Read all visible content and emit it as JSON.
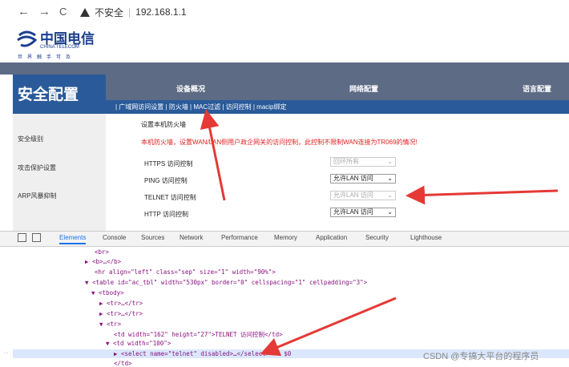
{
  "browser": {
    "back": "←",
    "forward": "→",
    "reload": "C",
    "security_text": "不安全",
    "url": "192.168.1.1"
  },
  "logo": {
    "cn": "中国电信",
    "en": "CHINA TELECOM",
    "sub": "世界触手可及"
  },
  "header": {
    "title": "安全配置",
    "menu": [
      "设备概况",
      "网络配置",
      "语言配置"
    ],
    "submenu": "| 广域网访问设置 | 防火墙 | MAC过滤 | 访问控制 | macip绑定"
  },
  "sidebar": {
    "items": [
      "安全级别",
      "攻击保护设置",
      "ARP风暴抑制"
    ]
  },
  "content": {
    "title": "设置本机防火墙",
    "warning": "本机防火墙，设置WAN/LAN侧用户政企网关的访问控制，此控制不限制WAN连接为TR069的情况!",
    "rows": [
      {
        "label": "HTTPS 访问控制",
        "value": "回环所有",
        "disabled": true
      },
      {
        "label": "PING 访问控制",
        "value": "允许LAN 访问",
        "disabled": false
      },
      {
        "label": "TELNET 访问控制",
        "value": "允许LAN 访问",
        "disabled": true
      },
      {
        "label": "HTTP 访问控制",
        "value": "允许LAN 访问",
        "disabled": false
      }
    ]
  },
  "devtools": {
    "tabs": [
      "Elements",
      "Console",
      "Sources",
      "Network",
      "Performance",
      "Memory",
      "Application",
      "Security",
      "Lighthouse"
    ],
    "active_tab": "Elements",
    "code_lines": [
      "<br>",
      "▶ <b>…</b>",
      "<hr align=\"left\" class=\"sep\" size=\"1\" width=\"90%\">",
      "▼ <table id=\"ac_tbl\" width=\"530px\" border=\"0\" cellspacing=\"1\" cellpadding=\"3\">",
      "▼ <tbody>",
      "▶ <tr>…</tr>",
      "▶ <tr>…</tr>",
      "▼ <tr>",
      "<td width=\"162\" height=\"27\">TELNET 访问控制</td>",
      "▼ <td width=\"100\">",
      "▶ <select name=\"telnet\" disabled>…</select> == $0",
      "</td>"
    ]
  },
  "watermark": "CSDN @专搞大平台的程序员",
  "colors": {
    "header_blue": "#2a5a99",
    "menu_gray": "#5d6b85",
    "warning_red": "#e02020",
    "arrow_red": "#e53935"
  }
}
